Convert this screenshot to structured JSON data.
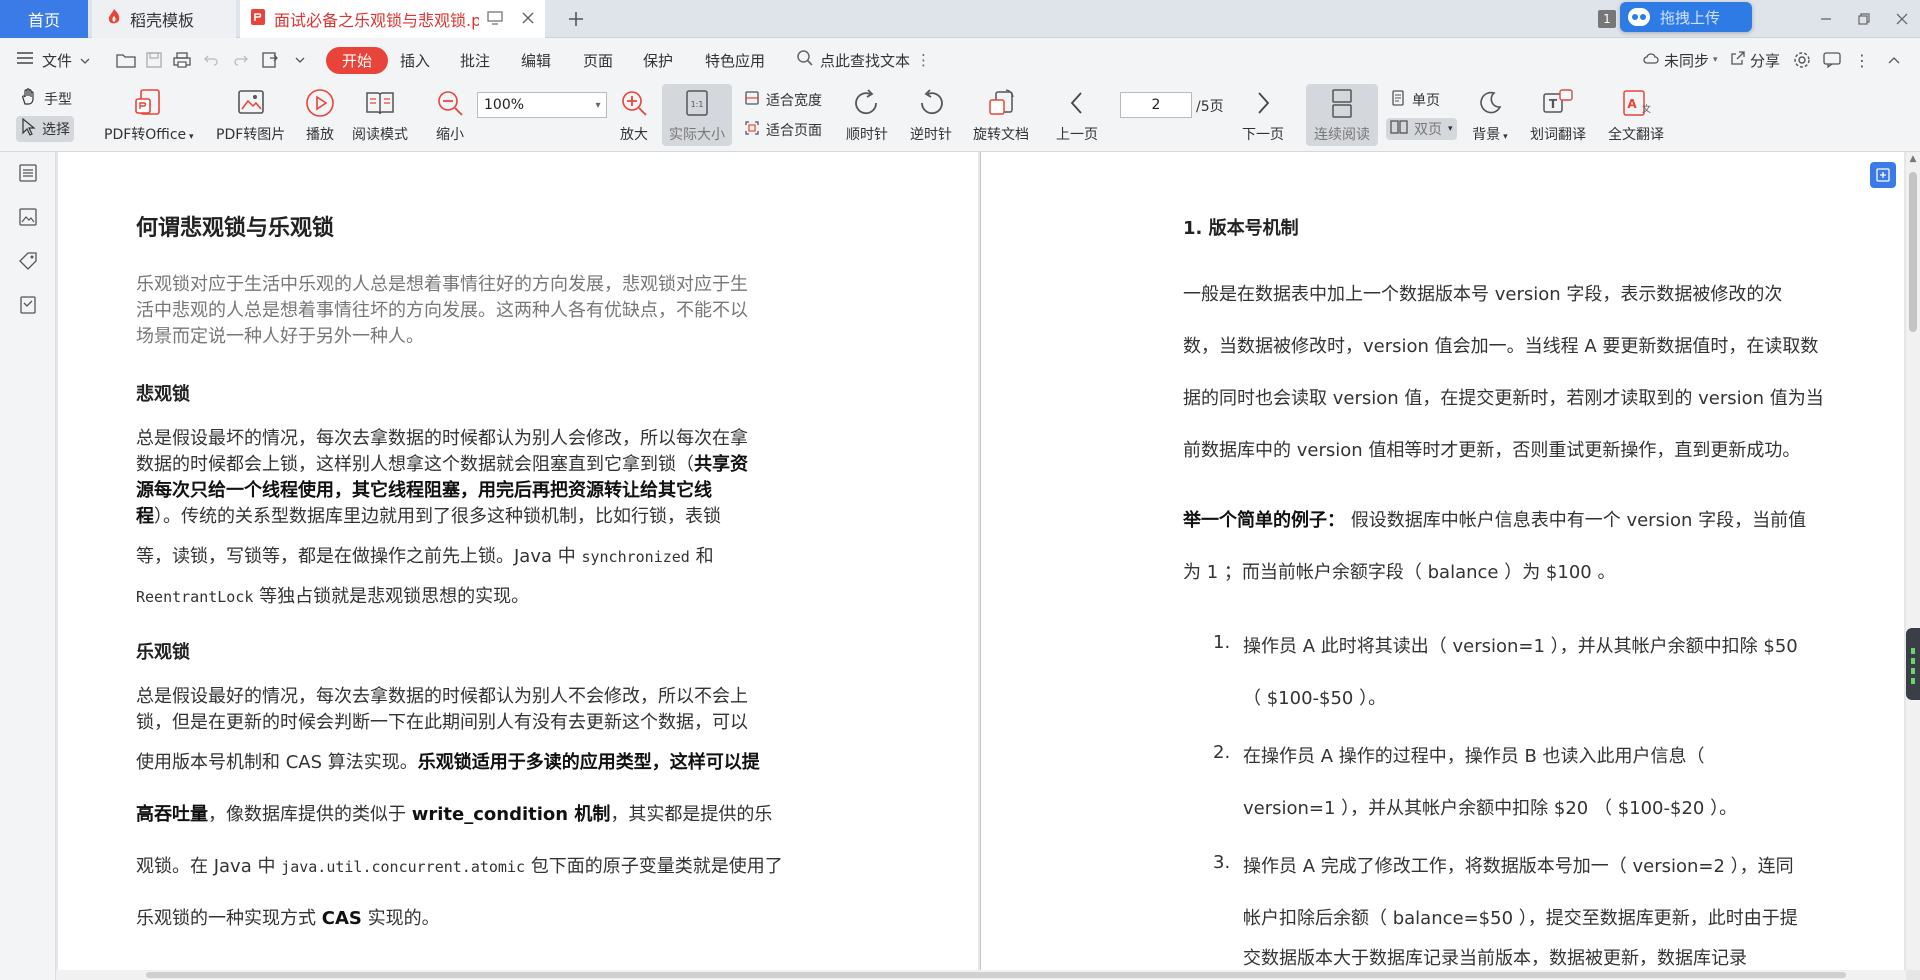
{
  "tabs": {
    "home": "首页",
    "template": "稻壳模板",
    "document": "面试必备之乐观锁与悲观锁.pdf",
    "upload": "拖拽上传",
    "badge": "1"
  },
  "menu": {
    "file": "文件",
    "start": "开始",
    "insert": "插入",
    "annotate": "批注",
    "edit": "编辑",
    "page": "页面",
    "protect": "保护",
    "special": "特色应用",
    "search": "点此查找文本",
    "sync": "未同步",
    "share": "分享"
  },
  "ribbon": {
    "hand": "手型",
    "select": "选择",
    "pdf_to_office": "PDF转Office",
    "pdf_to_image": "PDF转图片",
    "play": "播放",
    "read_mode": "阅读模式",
    "zoom_out": "缩小",
    "zoom_value": "100%",
    "zoom_in": "放大",
    "actual_size": "实际大小",
    "fit_width": "适合宽度",
    "fit_page": "适合页面",
    "clockwise": "顺时针",
    "counter_clockwise": "逆时针",
    "rotate_doc": "旋转文档",
    "prev_page": "上一页",
    "page_current": "2",
    "page_total": "/5页",
    "next_page": "下一页",
    "continuous": "连续阅读",
    "single": "单页",
    "double": "双页",
    "background": "背景",
    "word_translate": "划词翻译",
    "full_translate": "全文翻译"
  },
  "left_page": {
    "title": "何谓悲观锁与乐观锁",
    "intro": [
      "乐观锁对应于生活中乐观的人总是想着事情往好的方向发展，悲观锁对应于生",
      "活中悲观的人总是想着事情往坏的方向发展。这两种人各有优缺点，不能不以",
      "场景而定说一种人好于另外一种人。"
    ],
    "pessimistic_heading": "悲观锁",
    "pess_l1": "总是假设最坏的情况，每次去拿数据的时候都认为别人会修改，所以每次在拿",
    "pess_l2a": "数据的时候都会上锁，这样别人想拿这个数据就会阻塞直到它拿到锁（",
    "pess_l2b": "共享资",
    "pess_l3": "源每次只给一个线程使用，其它线程阻塞，用完后再把资源转让给其它线",
    "pess_l4a": "程",
    "pess_l4b": "）。传统的关系型数据库里边就用到了很多这种锁机制，比如行锁，表锁",
    "pess_l5a": "等，读锁，写锁等，都是在做操作之前先上锁。Java 中 ",
    "pess_l5b": "synchronized",
    "pess_l5c": " 和",
    "pess_l6a": "ReentrantLock",
    "pess_l6b": " 等独占锁就是悲观锁思想的实现。",
    "optimistic_heading": "乐观锁",
    "opt_l1": "总是假设最好的情况，每次去拿数据的时候都认为别人不会修改，所以不会上",
    "opt_l2": "锁，但是在更新的时候会判断一下在此期间别人有没有去更新这个数据，可以",
    "opt_l3a": "使用版本号机制和 CAS 算法实现。",
    "opt_l3b": "乐观锁适用于多读的应用类型，这样可以提",
    "opt_l4a": "高吞吐量",
    "opt_l4b": "，像数据库提供的类似于 ",
    "opt_l4c": "write_condition 机制",
    "opt_l4d": "，其实都是提供的乐",
    "opt_l5a": "观锁。在 Java 中 ",
    "opt_l5b": "java.util.concurrent.atomic",
    "opt_l5c": " 包下面的原子变量类就是使用了",
    "opt_l6a": "乐观锁的一种实现方式 ",
    "opt_l6b": "CAS",
    "opt_l6c": " 实现的。"
  },
  "right_page": {
    "heading": "1. 版本号机制",
    "para": [
      "一般是在数据表中加上一个数据版本号 version 字段，表示数据被修改的次",
      "数，当数据被修改时，version 值会加一。当线程 A 要更新数据值时，在读取数",
      "据的同时也会读取 version 值，在提交更新时，若刚才读取到的 version 值为当",
      "前数据库中的 version 值相等时才更新，否则重试更新操作，直到更新成功。"
    ],
    "example_bold": "举一个简单的例子：",
    "example_l1": " 假设数据库中帐户信息表中有一个  version  字段，当前值",
    "example_l2": "为  1  ；而当前帐户余额字段（  balance  ）为  $100  。",
    "items": [
      {
        "num": "1.",
        "l1": "操作员   A   此时将其读出（   version=1   ），并从其帐户余额中扣除   $50",
        "l2": "（   $100-$50   ）。"
      },
      {
        "num": "2.",
        "l1": "在操作员   A   操作的过程中，操作员 B   也读入此用户信息（",
        "l2": "version=1   ），并从其帐户余额中扣除   $20    （   $100-$20   ）。"
      },
      {
        "num": "3.",
        "l1": "操作员   A   完成了修改工作，将数据版本号加一（   version=2   ），连同",
        "l2": "帐户扣除后余额（   balance=$50   ），提交至数据库更新，此时由于提",
        "l3": "交数据版本大于数据库记录当前版本，数据被更新，数据库记录"
      }
    ]
  }
}
